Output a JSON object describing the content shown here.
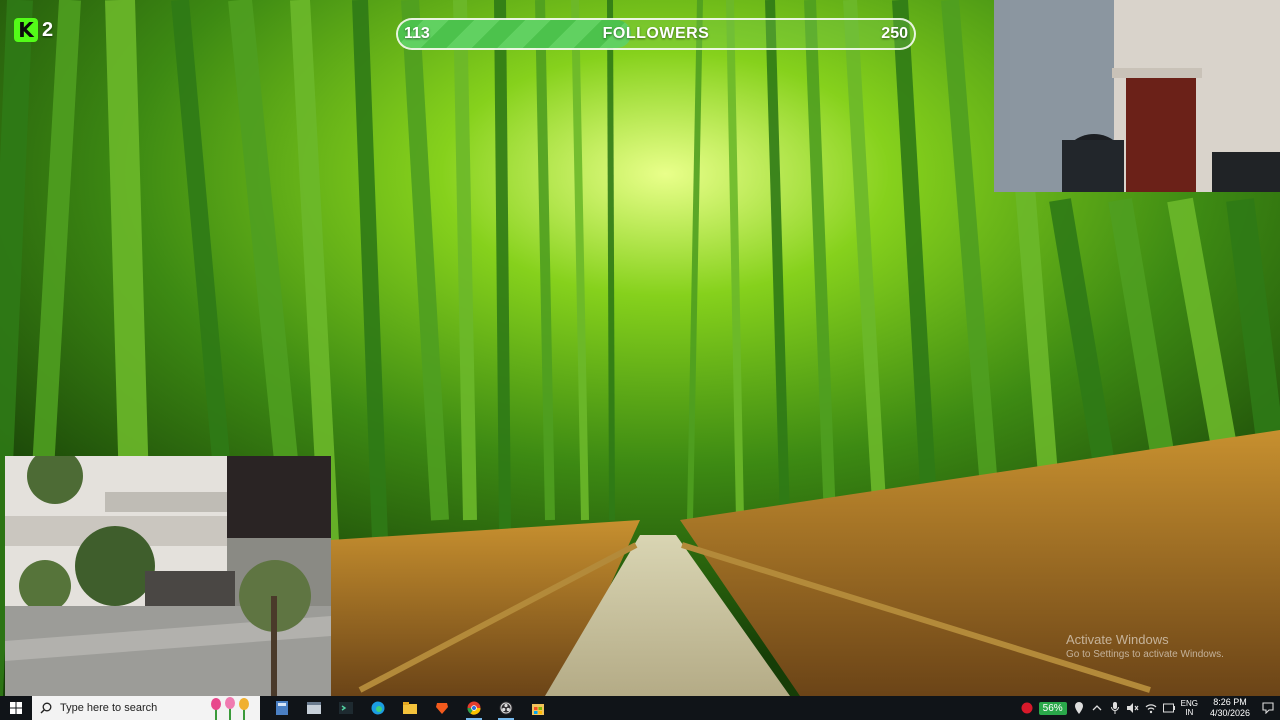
{
  "stream_overlay": {
    "viewer_count": "2",
    "followers_goal": {
      "current": "113",
      "label": "FOLLOWERS",
      "target": "250",
      "progress_fraction": 0.452
    }
  },
  "watermark": {
    "title": "Activate Windows",
    "subtitle": "Go to Settings to activate Windows."
  },
  "taskbar": {
    "search_placeholder": "Type here to search",
    "pinned_apps": [
      {
        "name": "calculator-icon",
        "active": false
      },
      {
        "name": "app-window-icon",
        "active": false
      },
      {
        "name": "terminal-icon",
        "active": false
      },
      {
        "name": "edge-icon",
        "active": false
      },
      {
        "name": "file-explorer-icon",
        "active": false
      },
      {
        "name": "brave-icon",
        "active": false
      },
      {
        "name": "chrome-icon",
        "active": true
      },
      {
        "name": "obs-icon",
        "active": true
      },
      {
        "name": "store-icon",
        "active": false
      }
    ],
    "tray": {
      "battery": "56%",
      "language_line1": "ENG",
      "language_line2": "IN",
      "time": "8:26 PM",
      "date": "4/30/2026"
    }
  },
  "colors": {
    "kick_green": "#53fc18",
    "goal_fill": "#4cc24c",
    "taskbar_bg": "#101418"
  }
}
